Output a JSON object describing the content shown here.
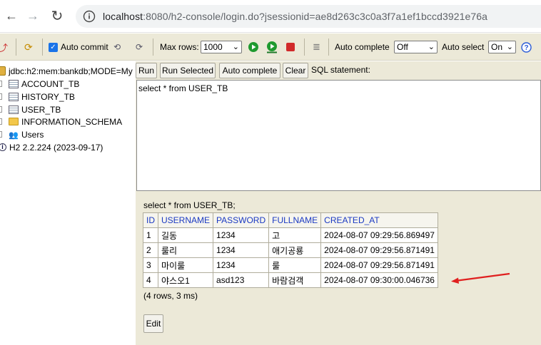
{
  "browser": {
    "url_host": "localhost",
    "url_rest": ":8080/h2-console/login.do?jsessionid=ae8d263c3c0a3f7a1ef1bccd3921e76a"
  },
  "toolbar": {
    "auto_commit_label": "Auto commit",
    "max_rows_label": "Max rows:",
    "max_rows_value": "1000",
    "auto_complete_label": "Auto complete",
    "auto_complete_value": "Off",
    "auto_select_label": "Auto select",
    "auto_select_value": "On"
  },
  "tree": {
    "connection": "jdbc:h2:mem:bankdb;MODE=My",
    "items": [
      {
        "label": "ACCOUNT_TB"
      },
      {
        "label": "HISTORY_TB"
      },
      {
        "label": "USER_TB"
      },
      {
        "label": "INFORMATION_SCHEMA"
      },
      {
        "label": "Users"
      }
    ],
    "version": "H2 2.2.224 (2023-09-17)"
  },
  "sql_panel": {
    "run": "Run",
    "run_selected": "Run Selected",
    "auto_complete": "Auto complete",
    "clear": "Clear",
    "label": "SQL statement:",
    "statement": "select * from USER_TB"
  },
  "result": {
    "sql": "select * from USER_TB;",
    "columns": [
      "ID",
      "USERNAME",
      "PASSWORD",
      "FULLNAME",
      "CREATED_AT"
    ],
    "rows": [
      [
        "1",
        "길동",
        "1234",
        "고",
        "2024-08-07 09:29:56.869497"
      ],
      [
        "2",
        "룰리",
        "1234",
        "애기공룡",
        "2024-08-07 09:29:56.871491"
      ],
      [
        "3",
        "마이룰",
        "1234",
        "룰",
        "2024-08-07 09:29:56.871491"
      ],
      [
        "4",
        "야스오1",
        "asd123",
        "바람검객",
        "2024-08-07 09:30:00.046736"
      ]
    ],
    "info": "(4 rows, 3 ms)",
    "edit": "Edit"
  },
  "colors": {
    "h2_bg": "#ece9d8",
    "header_text": "#1a39c2",
    "annotation_arrow": "#e0201f"
  }
}
